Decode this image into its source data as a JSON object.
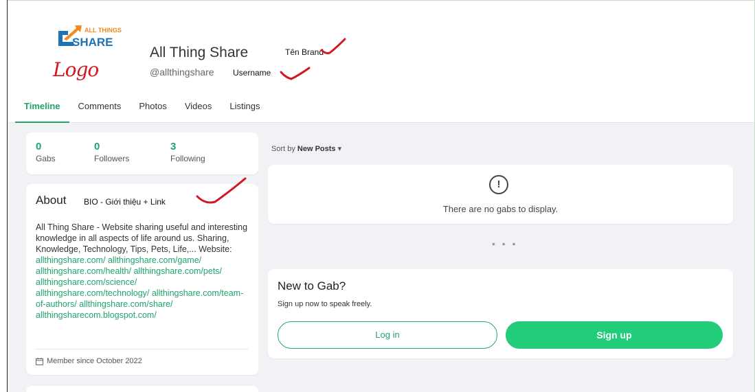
{
  "profile": {
    "logo_text_top": "ALL THINGS",
    "logo_text_bottom": "SHARE",
    "name": "All Thing Share",
    "username": "@allthingshare"
  },
  "annotations": {
    "logo": "Logo",
    "brand": "Tên Brand",
    "username": "Username",
    "bio": "BIO - Giới thiệu + Link"
  },
  "tabs": [
    {
      "label": "Timeline",
      "active": true
    },
    {
      "label": "Comments",
      "active": false
    },
    {
      "label": "Photos",
      "active": false
    },
    {
      "label": "Videos",
      "active": false
    },
    {
      "label": "Listings",
      "active": false
    }
  ],
  "stats": {
    "gabs": {
      "value": "0",
      "label": "Gabs"
    },
    "followers": {
      "value": "0",
      "label": "Followers"
    },
    "following": {
      "value": "3",
      "label": "Following"
    }
  },
  "about": {
    "title": "About",
    "bio": "All Thing Share - Website sharing useful and interesting knowledge in all aspects of life around us. Sharing, Knowledge, Technology, Tips, Pets, Life,... Website: ",
    "links": [
      "allthingshare.com/",
      "allthingshare.com/game/",
      "allthingshare.com/health/",
      "allthingshare.com/pets/",
      "allthingshare.com/science/",
      "allthingshare.com/technology/",
      "allthingshare.com/team-of-authors/",
      "allthingshare.com/share/",
      "allthingsharecom.blogspot.com/"
    ],
    "member_since": "Member since October 2022"
  },
  "feed": {
    "sort_prefix": "Sort by",
    "sort_value": "New Posts",
    "empty_message": "There are no gabs to display.",
    "empty_icon": "!",
    "more": "• • •"
  },
  "join": {
    "title": "New to Gab?",
    "subtitle": "Sign up now to speak freely.",
    "login_label": "Log in",
    "signup_label": "Sign up"
  },
  "colors": {
    "accent": "#21a36a",
    "signup": "#21cc7a",
    "annotation": "#d41620"
  }
}
